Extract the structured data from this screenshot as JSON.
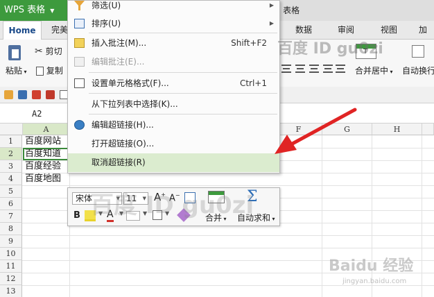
{
  "app": {
    "menu_button": "WPS 表格",
    "title_fragment": "s 表格"
  },
  "tabs": [
    "Home",
    "完美",
    "数据",
    "审阅",
    "视图",
    "加载"
  ],
  "toolbar": {
    "paste": "粘贴",
    "cut": "剪切",
    "copy": "复制",
    "merge": "合并居中",
    "wrap": "自动换行"
  },
  "formula_bar": {
    "name_box": "A2"
  },
  "columns": [
    "A",
    "F",
    "G",
    "H"
  ],
  "rows": [
    "1",
    "2",
    "3",
    "4",
    "5",
    "6",
    "7",
    "8",
    "9",
    "10",
    "11",
    "12",
    "13"
  ],
  "cells": [
    "百度网站",
    "百度知道",
    "百度经验",
    "百度地图"
  ],
  "context_menu": {
    "items": [
      {
        "label": "筛选(U)",
        "shortcut": "",
        "submenu": true,
        "disabled": false
      },
      {
        "label": "排序(U)",
        "shortcut": "",
        "submenu": true,
        "disabled": false
      },
      {
        "label": "插入批注(M)...",
        "shortcut": "Shift+F2",
        "submenu": false,
        "disabled": false
      },
      {
        "label": "编辑批注(E)...",
        "shortcut": "",
        "submenu": false,
        "disabled": true
      },
      {
        "label": "设置单元格格式(F)...",
        "shortcut": "Ctrl+1",
        "submenu": false,
        "disabled": false
      },
      {
        "label": "从下拉列表中选择(K)...",
        "shortcut": "",
        "submenu": false,
        "disabled": false
      },
      {
        "label": "编辑超链接(H)...",
        "shortcut": "",
        "submenu": false,
        "disabled": false
      },
      {
        "label": "打开超链接(O)...",
        "shortcut": "",
        "submenu": false,
        "disabled": false
      },
      {
        "label": "取消超链接(R)",
        "shortcut": "",
        "submenu": false,
        "disabled": false
      }
    ]
  },
  "mini_toolbar": {
    "font": "宋体",
    "size": "11",
    "bold": "B",
    "grow": "A",
    "shrink": "A",
    "font_color": "A",
    "merge": "合并",
    "autosum": "自动求和"
  },
  "watermarks": {
    "top": "百度 ID gu0zi",
    "middle": "百度 ID gu0zi",
    "baidu": "Baidu 经验",
    "baidu_url": "jingyan.baidu.com"
  },
  "colors": {
    "accent_green": "#3d9a3d",
    "hover": "#dbeccf",
    "annotation_arrow": "#e02424"
  }
}
